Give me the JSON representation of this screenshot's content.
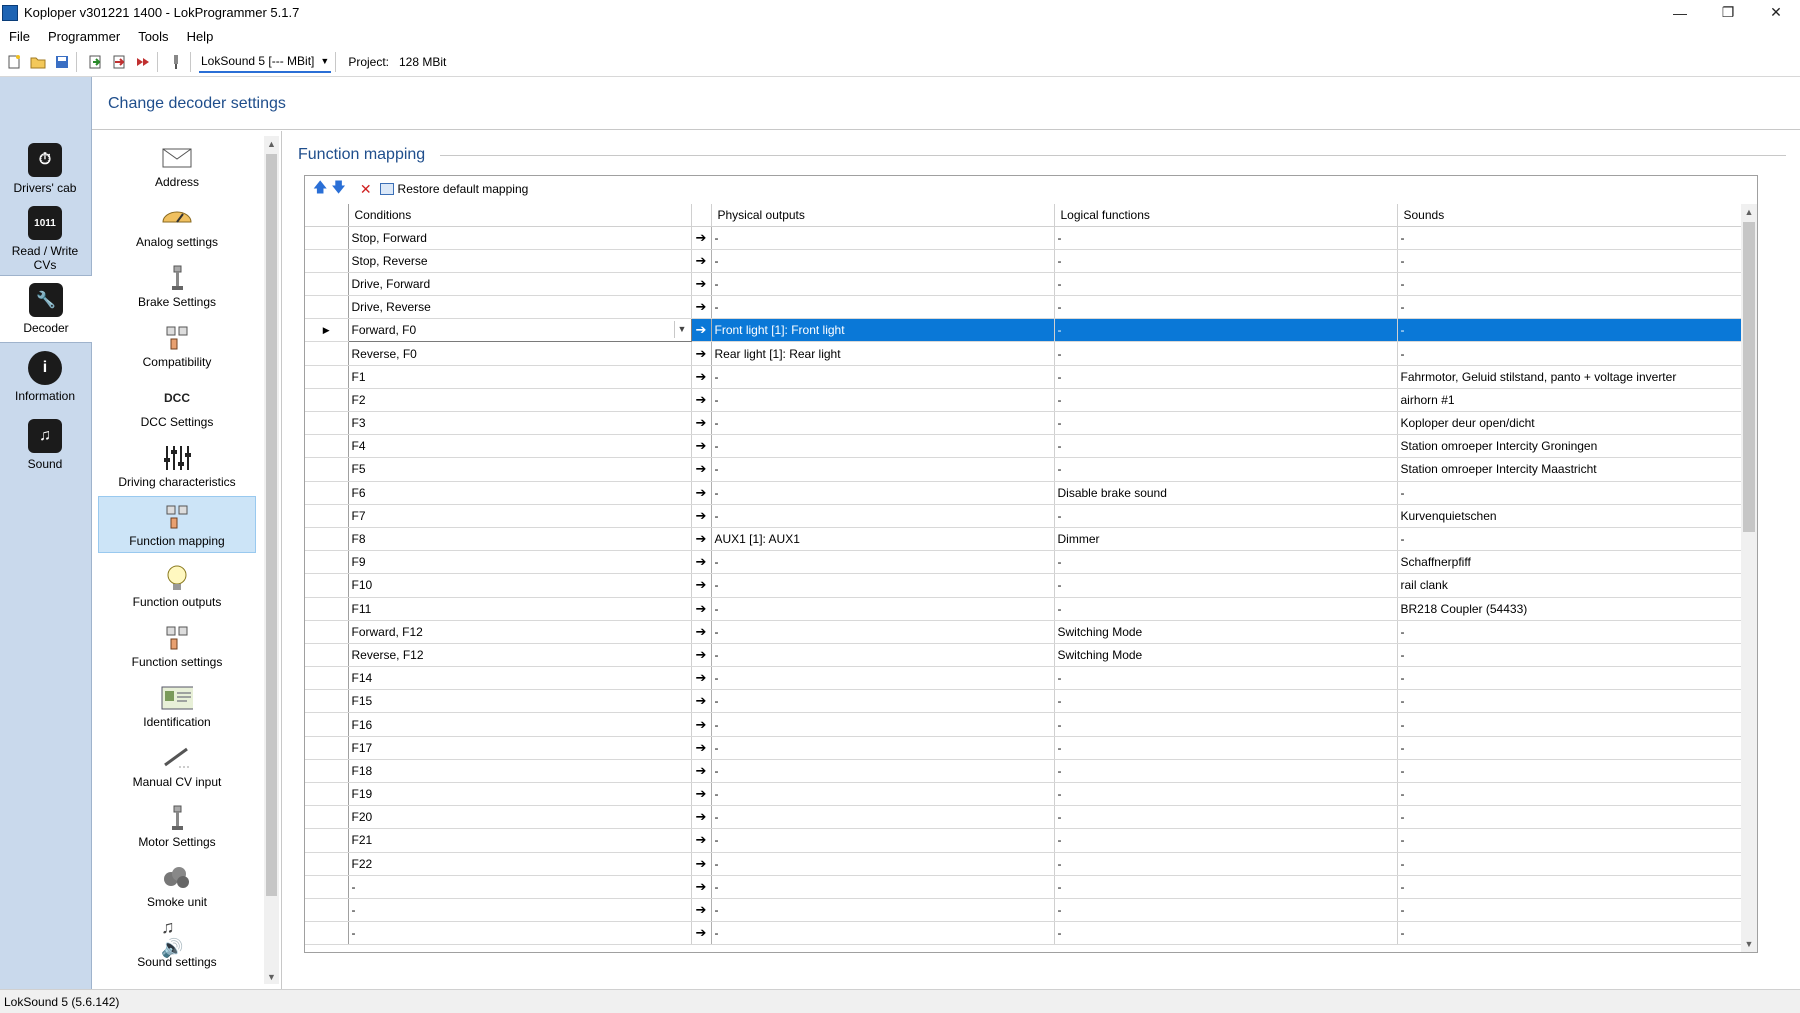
{
  "window": {
    "title": "Koploper v301221 1400 - LokProgrammer 5.1.7"
  },
  "menu": [
    "File",
    "Programmer",
    "Tools",
    "Help"
  ],
  "toolbar": {
    "device": "LokSound 5 [--- MBit]",
    "project_label": "Project:",
    "project_value": "128 MBit"
  },
  "leftnav": [
    {
      "label": "Drivers' cab",
      "icon": "drivers-cab-icon"
    },
    {
      "label": "Read / Write CVs",
      "icon": "read-write-cvs-icon"
    },
    {
      "label": "Decoder",
      "icon": "decoder-wrench-icon",
      "selected": true
    },
    {
      "label": "Information",
      "icon": "information-icon"
    },
    {
      "label": "Sound",
      "icon": "sound-note-icon"
    }
  ],
  "header": {
    "title": "Change decoder settings"
  },
  "settings": [
    {
      "label": "Address",
      "icon": "envelope-icon"
    },
    {
      "label": "Analog settings",
      "icon": "gauge-icon"
    },
    {
      "label": "Brake Settings",
      "icon": "brake-lever-icon"
    },
    {
      "label": "Compatibility",
      "icon": "hand-switches-icon"
    },
    {
      "label": "DCC Settings",
      "icon": "dcc-icon"
    },
    {
      "label": "Driving characteristics",
      "icon": "sliders-icon"
    },
    {
      "label": "Function mapping",
      "icon": "hand-switches-icon",
      "selected": true
    },
    {
      "label": "Function outputs",
      "icon": "light-bulb-icon"
    },
    {
      "label": "Function settings",
      "icon": "hand-switches-icon"
    },
    {
      "label": "Identification",
      "icon": "id-card-icon"
    },
    {
      "label": "Manual CV input",
      "icon": "pen-icon"
    },
    {
      "label": "Motor Settings",
      "icon": "motor-lever-icon"
    },
    {
      "label": "Smoke unit",
      "icon": "smoke-icon"
    },
    {
      "label": "Sound settings",
      "icon": "sound-settings-icon"
    }
  ],
  "function_mapping": {
    "title": "Function mapping",
    "restore_label": "Restore default mapping",
    "columns": [
      "Conditions",
      "Physical outputs",
      "Logical functions",
      "Sounds"
    ],
    "rows": [
      [
        "Stop, Forward",
        "-",
        "-",
        "-"
      ],
      [
        "Stop, Reverse",
        "-",
        "-",
        "-"
      ],
      [
        "Drive, Forward",
        "-",
        "-",
        "-"
      ],
      [
        "Drive, Reverse",
        "-",
        "-",
        "-"
      ],
      [
        "Forward, F0",
        "Front light [1]: Front light",
        "-",
        "-"
      ],
      [
        "Reverse, F0",
        "Rear light [1]: Rear light",
        "-",
        "-"
      ],
      [
        "F1",
        "-",
        "-",
        "Fahrmotor, Geluid stilstand, panto + voltage inverter"
      ],
      [
        "F2",
        "-",
        "-",
        "airhorn #1"
      ],
      [
        "F3",
        "-",
        "-",
        "Koploper deur open/dicht"
      ],
      [
        "F4",
        "-",
        "-",
        "Station omroeper Intercity Groningen"
      ],
      [
        "F5",
        "-",
        "-",
        "Station omroeper Intercity Maastricht"
      ],
      [
        "F6",
        "-",
        "Disable brake sound",
        "-"
      ],
      [
        "F7",
        "-",
        "-",
        "Kurvenquietschen"
      ],
      [
        "F8",
        "AUX1 [1]: AUX1",
        "Dimmer",
        "-"
      ],
      [
        "F9",
        "-",
        "-",
        "Schaffnerpfiff"
      ],
      [
        "F10",
        "-",
        "-",
        "rail clank"
      ],
      [
        "F11",
        "-",
        "-",
        "BR218 Coupler (54433)"
      ],
      [
        "Forward, F12",
        "-",
        "Switching Mode",
        "-"
      ],
      [
        "Reverse, F12",
        "-",
        "Switching Mode",
        "-"
      ],
      [
        "F14",
        "-",
        "-",
        "-"
      ],
      [
        "F15",
        "-",
        "-",
        "-"
      ],
      [
        "F16",
        "-",
        "-",
        "-"
      ],
      [
        "F17",
        "-",
        "-",
        "-"
      ],
      [
        "F18",
        "-",
        "-",
        "-"
      ],
      [
        "F19",
        "-",
        "-",
        "-"
      ],
      [
        "F20",
        "-",
        "-",
        "-"
      ],
      [
        "F21",
        "-",
        "-",
        "-"
      ],
      [
        "F22",
        "-",
        "-",
        "-"
      ],
      [
        "-",
        "-",
        "-",
        "-"
      ],
      [
        "-",
        "-",
        "-",
        "-"
      ],
      [
        "-",
        "-",
        "-",
        "-"
      ]
    ],
    "selected_row": 4
  },
  "status": {
    "text": "LokSound 5 (5.6.142)"
  }
}
